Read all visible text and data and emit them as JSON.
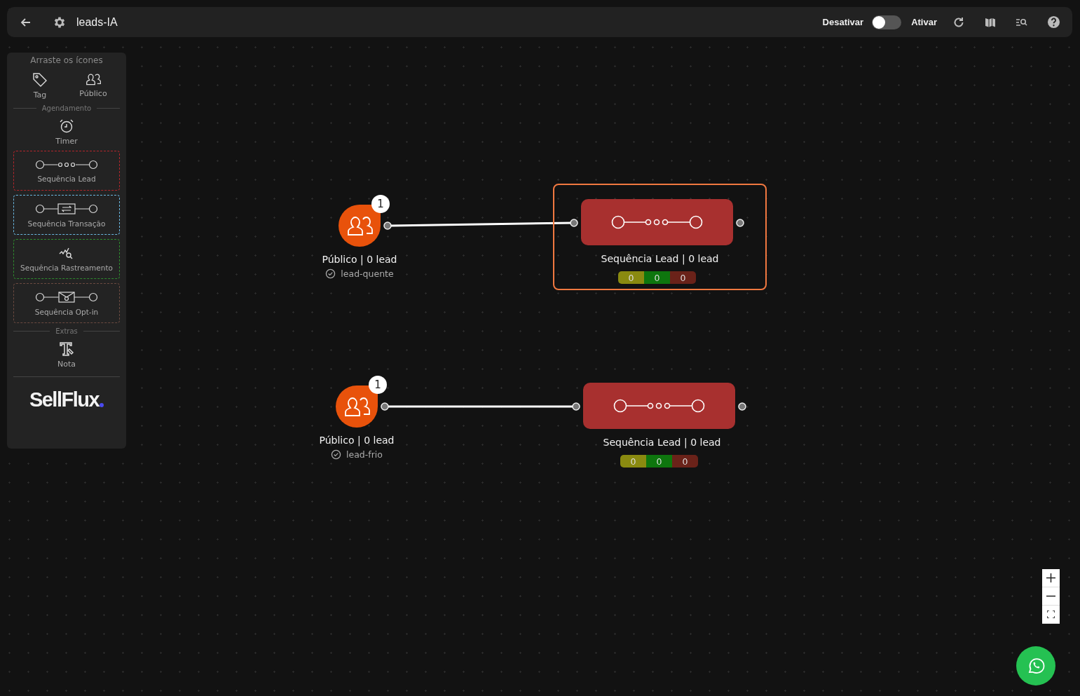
{
  "header": {
    "title": "leads-IA",
    "toggle": {
      "off_label": "Desativar",
      "on_label": "Ativar",
      "on": false
    }
  },
  "palette": {
    "heading": "Arraste os ícones",
    "items": [
      {
        "kind": "tag",
        "label": "Tag"
      },
      {
        "kind": "audience",
        "label": "Público"
      },
      {
        "kind": "divider",
        "label": "Agendamento"
      },
      {
        "kind": "timer",
        "label": "Timer"
      },
      {
        "kind": "seq-lead",
        "label": "Sequência Lead",
        "color": "#b3262b"
      },
      {
        "kind": "seq-transaction",
        "label": "Sequência Transação",
        "color": "#6ab7e0"
      },
      {
        "kind": "seq-tracking",
        "label": "Sequência Rastreamento",
        "color": "#2e8b2e"
      },
      {
        "kind": "seq-optin",
        "label": "Sequência Opt-in",
        "color": "#6b4a40"
      },
      {
        "kind": "divider",
        "label": "Extras"
      },
      {
        "kind": "note",
        "label": "Nota"
      }
    ],
    "logo": "SellFlux"
  },
  "flows": [
    {
      "source": {
        "label": "Público | 0 lead",
        "tag": "lead-quente",
        "badge": "1"
      },
      "target": {
        "label": "Sequência Lead | 0 lead",
        "selected": true,
        "counts": [
          {
            "value": "0",
            "color": "#8a8a10"
          },
          {
            "value": "0",
            "color": "#0e760e"
          },
          {
            "value": "0",
            "color": "#6a2219"
          }
        ]
      }
    },
    {
      "source": {
        "label": "Público | 0 lead",
        "tag": "lead-frio",
        "badge": "1"
      },
      "target": {
        "label": "Sequência Lead | 0 lead",
        "selected": false,
        "counts": [
          {
            "value": "0",
            "color": "#8a8a10"
          },
          {
            "value": "0",
            "color": "#0e760e"
          },
          {
            "value": "0",
            "color": "#6a2219"
          }
        ]
      }
    }
  ]
}
